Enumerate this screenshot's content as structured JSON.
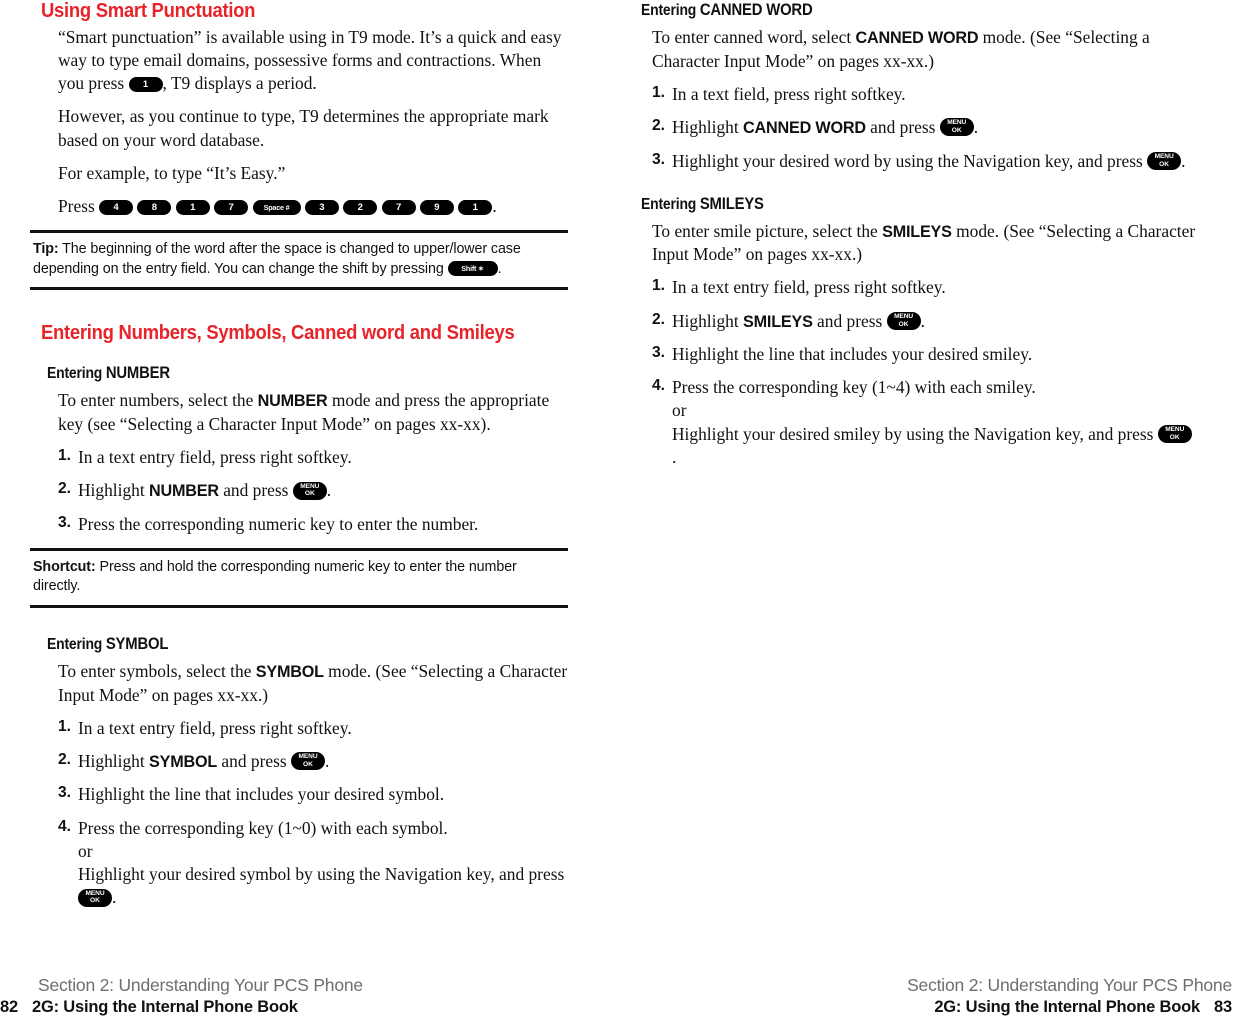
{
  "left_page": {
    "heading": "Using Smart Punctuation",
    "paragraphs": [
      {
        "pre": "“Smart punctuation” is available using in T9 mode. It’s a quick and easy way to type email domains, possessive forms and contractions. When you press ",
        "key": "1",
        "post": ", T9 displays a period."
      },
      {
        "text": "However, as you continue to type, T9 determines the appropriate mark based on your word database."
      },
      {
        "text": "For example, to type “It’s Easy.”"
      }
    ],
    "press_line": {
      "label": "Press",
      "keys": [
        "4",
        "8",
        "1",
        "7",
        "Space #",
        "3",
        "2",
        "7",
        "9",
        "1"
      ],
      "trailing": "."
    },
    "tip": {
      "label": "Tip:",
      "text_before_key": " The beginning of the word after the space is changed to upper/lower case depending on the entry field. You can change the shift by pressing ",
      "key": "Shift ✶",
      "text_after_key": "."
    },
    "section_heading": "Entering Numbers, Symbols, Canned word and Smileys",
    "number_section": {
      "subheading_prefix": "Entering ",
      "subheading_mode": "NUMBER",
      "intro_parts": {
        "a": "To enter numbers, select the ",
        "mode": "NUMBER",
        "b": " mode and press the appropriate key (see “Selecting a Character Input Mode” on pages xx-xx)."
      },
      "steps": [
        {
          "num": "1.",
          "a": "In a text entry field, press right softkey.",
          "mode": "",
          "b": "",
          "key": "",
          "c": ""
        },
        {
          "num": "2.",
          "a": "Highlight ",
          "mode": "NUMBER",
          "b": " and press ",
          "key": "MENU/OK",
          "c": "."
        },
        {
          "num": "3.",
          "a": "Press the corresponding numeric key to enter the number.",
          "mode": "",
          "b": "",
          "key": "",
          "c": ""
        }
      ]
    },
    "shortcut": {
      "label": "Shortcut:",
      "text": " Press and hold the corresponding numeric key to enter the number directly."
    },
    "symbol_section": {
      "subheading_prefix": "Entering ",
      "subheading_mode": "SYMBOL",
      "intro_parts": {
        "a": "To enter symbols, select the ",
        "mode": "SYMBOL",
        "b": " mode. (See “Selecting a Character Input Mode” on pages xx-xx.)"
      },
      "steps": [
        {
          "num": "1.",
          "a": "In a text entry field, press right softkey.",
          "mode": "",
          "b": "",
          "key": "",
          "c": ""
        },
        {
          "num": "2.",
          "a": "Highlight ",
          "mode": "SYMBOL",
          "b": " and press ",
          "key": "MENU/OK",
          "c": "."
        },
        {
          "num": "3.",
          "a": "Highlight the line that includes your desired symbol.",
          "mode": "",
          "b": "",
          "key": "",
          "c": ""
        },
        {
          "num": "4.",
          "a": "Press the corresponding key (1~0) with each symbol.",
          "mode": "",
          "b": "",
          "key": "",
          "c": "",
          "sub_or": "or",
          "sub_text_a": "Highlight your desired symbol by using the Navigation key, and press ",
          "sub_key": "MENU/OK",
          "sub_text_b": "."
        }
      ]
    },
    "footer": {
      "line1": "Section 2: Understanding Your PCS Phone",
      "page": "82",
      "line2": "2G: Using the Internal Phone Book"
    }
  },
  "right_page": {
    "canned_section": {
      "subheading_prefix": "Entering ",
      "subheading_mode": "CANNED WORD",
      "intro_parts": {
        "a": "To enter canned word, select ",
        "mode": "CANNED WORD",
        "b": " mode. (See “Selecting a Character Input Mode” on pages xx-xx.)"
      },
      "steps": [
        {
          "num": "1.",
          "a": "In a text field, press right softkey.",
          "mode": "",
          "b": "",
          "key": "",
          "c": ""
        },
        {
          "num": "2.",
          "a": "Highlight ",
          "mode": "CANNED WORD",
          "b": " and press ",
          "key": "MENU/OK",
          "c": "."
        },
        {
          "num": "3.",
          "a": "Highlight your desired word by using the Navigation key, and press ",
          "mode": "",
          "b": "",
          "key": "MENU/OK",
          "c": "."
        }
      ]
    },
    "smileys_section": {
      "subheading_prefix": "Entering ",
      "subheading_mode": "SMILEYS",
      "intro_parts": {
        "a": "To enter smile picture, select the ",
        "mode": "SMILEYS",
        "b": " mode. (See “Selecting a Character Input Mode” on pages xx-xx.)"
      },
      "steps": [
        {
          "num": "1.",
          "a": "In a text entry field, press right softkey.",
          "mode": "",
          "b": "",
          "key": "",
          "c": ""
        },
        {
          "num": "2.",
          "a": "Highlight ",
          "mode": "SMILEYS",
          "b": " and press ",
          "key": "MENU/OK",
          "c": "."
        },
        {
          "num": "3.",
          "a": "Highlight the line that includes your desired smiley.",
          "mode": "",
          "b": "",
          "key": "",
          "c": ""
        },
        {
          "num": "4.",
          "a": "Press the corresponding key (1~4) with each smiley.",
          "mode": "",
          "b": "",
          "key": "",
          "c": "",
          "sub_or": "or",
          "sub_text_a": "Highlight your desired smiley by using the Navigation key, and press ",
          "sub_key": "MENU/OK",
          "sub_text_b": "."
        }
      ]
    },
    "footer": {
      "line1": "Section 2: Understanding Your PCS Phone",
      "page": "83",
      "line2": "2G: Using the Internal Phone Book"
    }
  },
  "colors": {
    "heading_red": "#E8232A",
    "footer_gray": "#6E6E6E",
    "key_background": "#000000",
    "key_text": "#FFFFFF"
  },
  "key_labels": {
    "menu_ok_line1": "MENU",
    "menu_ok_line2": "OK"
  }
}
